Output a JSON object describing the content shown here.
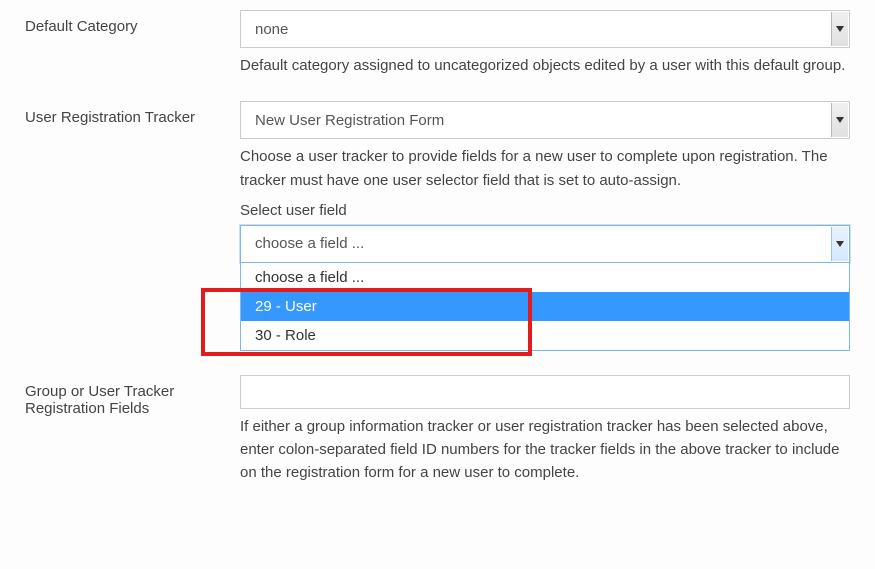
{
  "fields": {
    "default_category": {
      "label": "Default Category",
      "selected": "none",
      "help": "Default category assigned to uncategorized objects edited by a user with this default group."
    },
    "user_reg_tracker": {
      "label": "User Registration Tracker",
      "selected": "New User Registration Form",
      "help": "Choose a user tracker to provide fields for a new user to complete upon registration. The tracker must have one user selector field that is set to auto-assign.",
      "sub_label": "Select user field",
      "field_select": {
        "selected": "choose a field ...",
        "options": {
          "placeholder": "choose a field ...",
          "opt1": "29 - User",
          "opt2": "30 - Role"
        }
      }
    },
    "group_user_tracker_fields": {
      "label": "Group or User Tracker Registration Fields",
      "value": "",
      "help": "If either a group information tracker or user registration tracker has been selected above, enter colon-separated field ID numbers for the tracker fields in the above tracker to include on the registration form for a new user to complete."
    }
  }
}
